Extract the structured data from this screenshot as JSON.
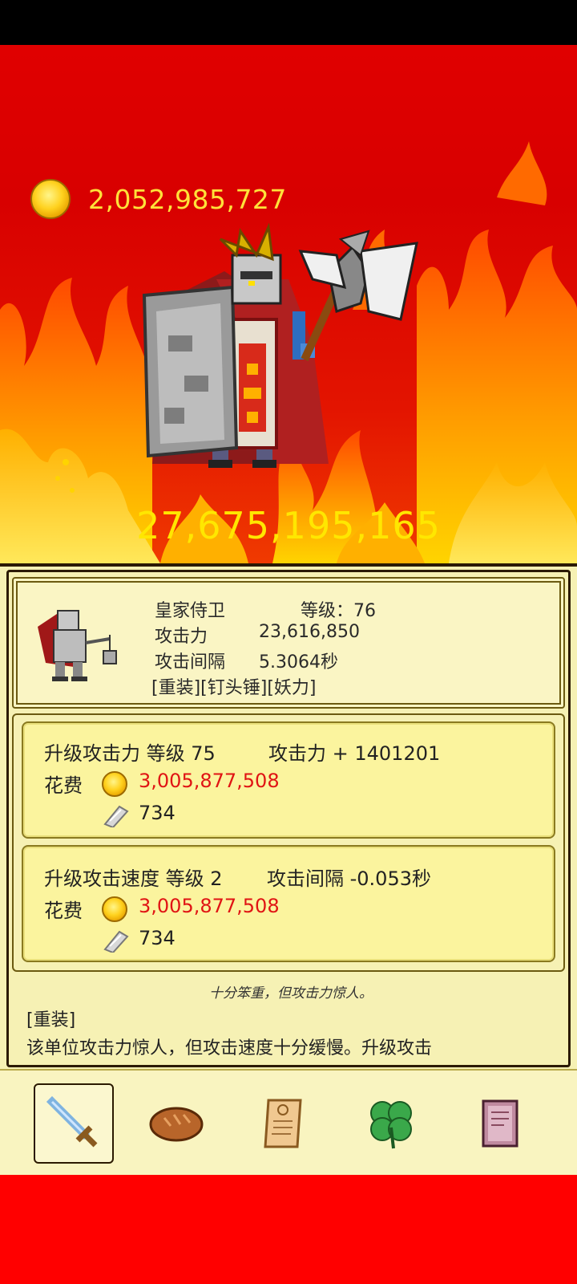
{
  "gold": {
    "amount": "2,052,985,727",
    "icon": "gold-coin-icon"
  },
  "damage_total": "27,675,195,165",
  "unit": {
    "name": "皇家侍卫",
    "level_label": "等级：76",
    "attack_label": "攻击力",
    "attack_value": "23,616,850",
    "interval_label": "攻击间隔",
    "interval_value": "5.3064秒",
    "tags": "[重装][钉头锤][妖力]"
  },
  "upgrades": [
    {
      "title": "升级攻击力 等级 75",
      "effect": "攻击力 + 1401201",
      "cost_label": "花费",
      "gold_cost": "3,005,877,508",
      "ingot_cost": "734"
    },
    {
      "title": "升级攻击速度 等级 2",
      "effect": "攻击间隔 -0.053秒",
      "cost_label": "花费",
      "gold_cost": "3,005,877,508",
      "ingot_cost": "734"
    }
  ],
  "flavor_text": "十分笨重，但攻击力惊人。",
  "trait": {
    "title": "[重装]",
    "description": "该单位攻击力惊人，但攻击速度十分缓慢。升级攻击"
  },
  "nav": [
    {
      "icon": "sword-icon",
      "active": true
    },
    {
      "icon": "bread-icon",
      "active": false
    },
    {
      "icon": "scroll-icon",
      "active": false
    },
    {
      "icon": "clover-icon",
      "active": false
    },
    {
      "icon": "book-icon",
      "active": false
    }
  ],
  "colors": {
    "background_red": "#e00000",
    "gold_text": "#ffe23a",
    "damage_text": "#ffe700",
    "panel_bg": "#f6f1b4",
    "cost_red": "#e01414"
  }
}
